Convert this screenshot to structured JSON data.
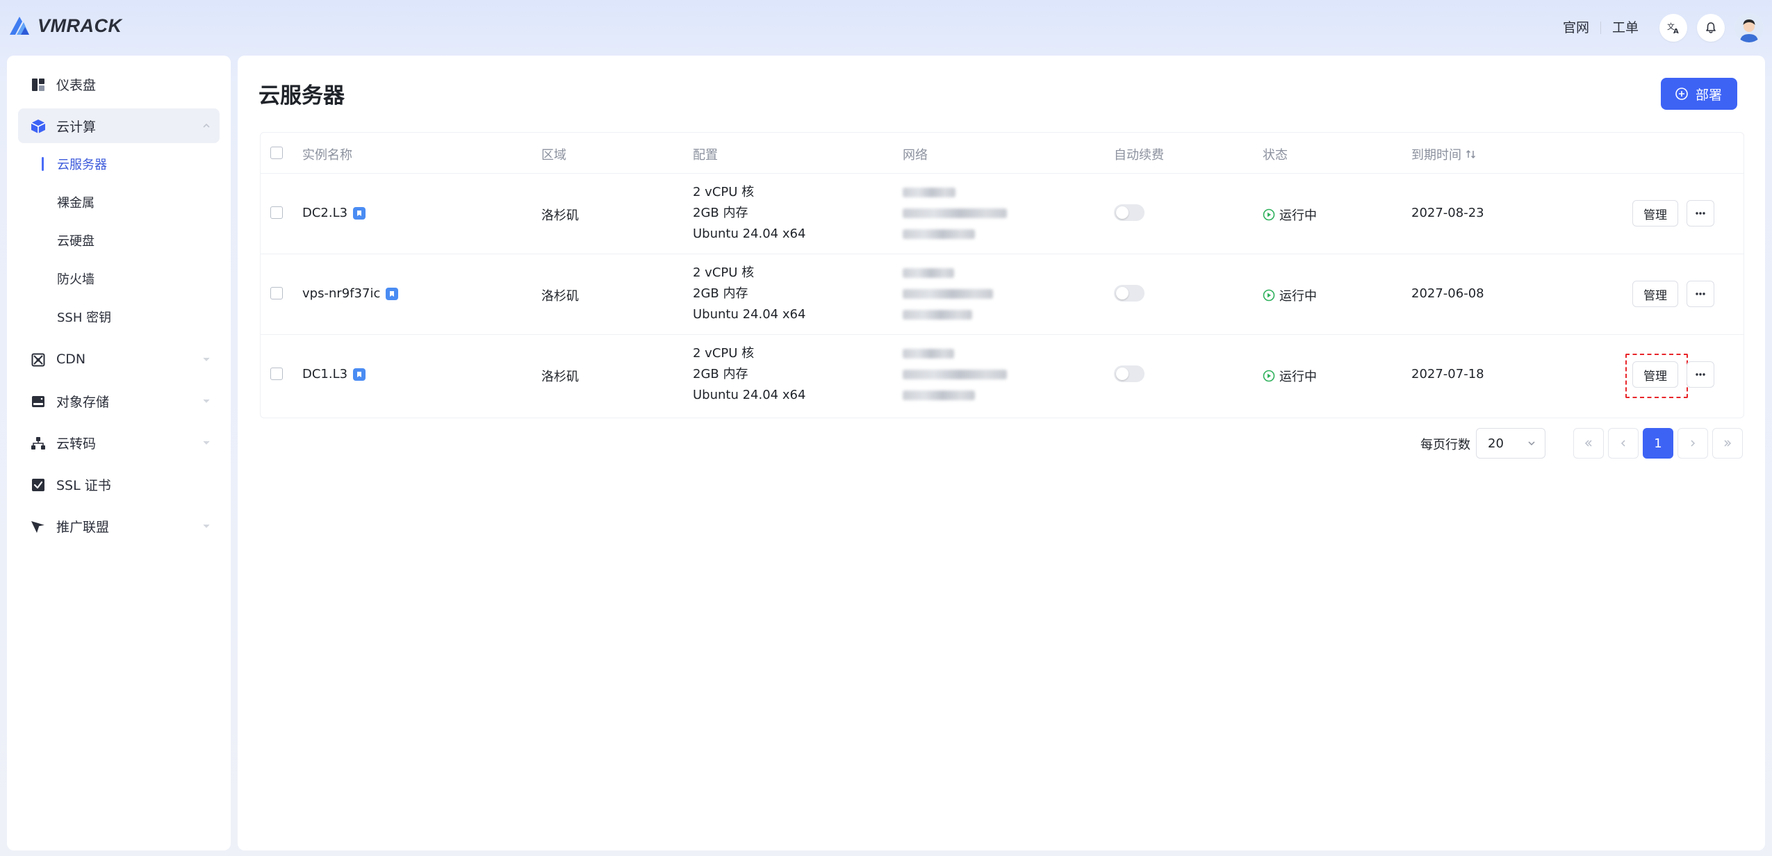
{
  "brand": {
    "name": "VMRACK"
  },
  "topbar": {
    "links": [
      "官网",
      "工单"
    ],
    "icons": [
      "translate-icon",
      "bell-icon",
      "avatar"
    ]
  },
  "sidebar": {
    "items": [
      {
        "label": "仪表盘",
        "icon": "dashboard-icon"
      },
      {
        "label": "云计算",
        "icon": "cube-icon",
        "expanded": true,
        "children": [
          "云服务器",
          "裸金属",
          "云硬盘",
          "防火墙",
          "SSH 密钥"
        ]
      },
      {
        "label": "CDN",
        "icon": "cdn-icon"
      },
      {
        "label": "对象存储",
        "icon": "storage-icon"
      },
      {
        "label": "云转码",
        "icon": "transcode-icon"
      },
      {
        "label": "SSL 证书",
        "icon": "certificate-icon"
      },
      {
        "label": "推广联盟",
        "icon": "paper-plane-icon"
      }
    ]
  },
  "main": {
    "title": "云服务器",
    "deploy_label": "部署",
    "columns": [
      "实例名称",
      "区域",
      "配置",
      "网络",
      "自动续费",
      "状态",
      "到期时间"
    ],
    "rows": [
      {
        "name": "DC2.L3",
        "region": "洛杉矶",
        "cpu": "2 vCPU 核",
        "mem": "2GB 内存",
        "os": "Ubuntu 24.04 x64",
        "auto_renew": false,
        "status": "运行中",
        "expires": "2027-08-23",
        "manage": "管理"
      },
      {
        "name": "vps-nr9f37ic",
        "region": "洛杉矶",
        "cpu": "2 vCPU 核",
        "mem": "2GB 内存",
        "os": "Ubuntu 24.04 x64",
        "auto_renew": false,
        "status": "运行中",
        "expires": "2027-06-08",
        "manage": "管理"
      },
      {
        "name": "DC1.L3",
        "region": "洛杉矶",
        "cpu": "2 vCPU 核",
        "mem": "2GB 内存",
        "os": "Ubuntu 24.04 x64",
        "auto_renew": false,
        "status": "运行中",
        "expires": "2027-07-18",
        "manage": "管理"
      }
    ],
    "pagination": {
      "rows_per_page_label": "每页行数",
      "rows_per_page": "20",
      "current_page": "1"
    }
  },
  "colors": {
    "accent": "#3d63f5",
    "status_running": "#2fb15c",
    "highlight": "#e8262a"
  }
}
